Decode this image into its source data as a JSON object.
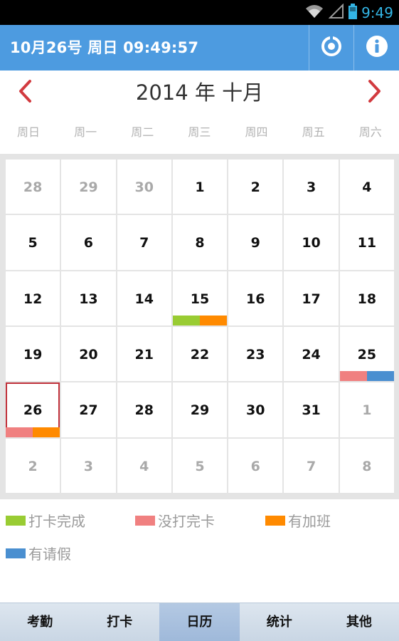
{
  "status_bar": {
    "time": "9:49",
    "icons": [
      "wifi-icon",
      "signal-icon",
      "battery-icon"
    ]
  },
  "header": {
    "title": "10月26号 周日 09:49:57",
    "icons": [
      "sync-icon",
      "info-icon"
    ],
    "colors": {
      "background": "#4d9be0"
    }
  },
  "calendar": {
    "month_label": "2014 年 十月",
    "weekdays": [
      "周日",
      "周一",
      "周二",
      "周三",
      "周四",
      "周五",
      "周六"
    ],
    "nav_color": "#d23a3f",
    "days": [
      {
        "label": "28",
        "other": true
      },
      {
        "label": "29",
        "other": true
      },
      {
        "label": "30",
        "other": true
      },
      {
        "label": "1"
      },
      {
        "label": "2"
      },
      {
        "label": "3"
      },
      {
        "label": "4"
      },
      {
        "label": "5"
      },
      {
        "label": "6"
      },
      {
        "label": "7"
      },
      {
        "label": "8"
      },
      {
        "label": "9"
      },
      {
        "label": "10"
      },
      {
        "label": "11"
      },
      {
        "label": "12"
      },
      {
        "label": "13"
      },
      {
        "label": "14"
      },
      {
        "label": "15",
        "marks": [
          "green",
          "orange"
        ]
      },
      {
        "label": "16"
      },
      {
        "label": "17"
      },
      {
        "label": "18"
      },
      {
        "label": "19"
      },
      {
        "label": "20"
      },
      {
        "label": "21"
      },
      {
        "label": "22"
      },
      {
        "label": "23"
      },
      {
        "label": "24"
      },
      {
        "label": "25",
        "marks": [
          "pink",
          "blue"
        ]
      },
      {
        "label": "26",
        "today": true,
        "marks": [
          "pink",
          "orange"
        ]
      },
      {
        "label": "27"
      },
      {
        "label": "28"
      },
      {
        "label": "29"
      },
      {
        "label": "30"
      },
      {
        "label": "31"
      },
      {
        "label": "1",
        "other": true
      },
      {
        "label": "2",
        "other": true
      },
      {
        "label": "3",
        "other": true
      },
      {
        "label": "4",
        "other": true
      },
      {
        "label": "5",
        "other": true
      },
      {
        "label": "6",
        "other": true
      },
      {
        "label": "7",
        "other": true
      },
      {
        "label": "8",
        "other": true
      }
    ]
  },
  "legend": {
    "items": [
      {
        "label": "打卡完成",
        "color": "#99cc33"
      },
      {
        "label": "没打完卡",
        "color": "#f08080"
      },
      {
        "label": "有加班",
        "color": "#ff8a00"
      },
      {
        "label": "有请假",
        "color": "#4a8fd0"
      }
    ]
  },
  "mark_colors": {
    "green": "#99cc33",
    "pink": "#f08080",
    "orange": "#ff8a00",
    "blue": "#4a8fd0"
  },
  "tabs": [
    {
      "label": "考勤"
    },
    {
      "label": "打卡"
    },
    {
      "label": "日历",
      "active": true
    },
    {
      "label": "统计"
    },
    {
      "label": "其他"
    }
  ]
}
